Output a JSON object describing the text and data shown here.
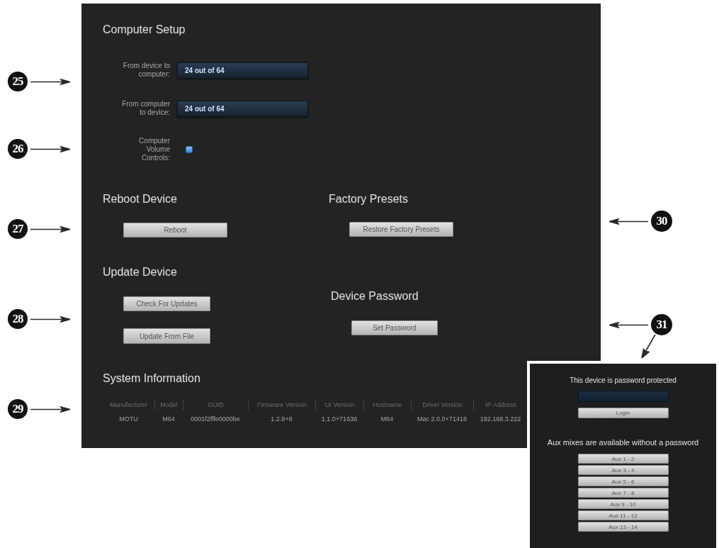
{
  "callouts": [
    {
      "number": "25",
      "kind": "arrow-right"
    },
    {
      "number": "26",
      "kind": "arrow-right"
    },
    {
      "number": "27",
      "kind": "arrow-right"
    },
    {
      "number": "28",
      "kind": "arrow-right"
    },
    {
      "number": "29",
      "kind": "arrow-right"
    },
    {
      "number": "30",
      "kind": "arrow-left"
    },
    {
      "number": "31",
      "kind": "arrow-left-down"
    }
  ],
  "settings": {
    "computer_setup": {
      "title": "Computer Setup",
      "fields": [
        {
          "label": "From device to computer:",
          "value": "24 out of 64"
        },
        {
          "label": "From computer to device:",
          "value": "24 out of 64"
        }
      ],
      "volume_controls": {
        "label": "Computer Volume Controls:",
        "checked": true
      }
    },
    "reboot_device": {
      "title": "Reboot Device",
      "button": "Reboot"
    },
    "update_device": {
      "title": "Update Device",
      "buttons": [
        "Check For Updates",
        "Update From File"
      ]
    },
    "factory_presets": {
      "title": "Factory Presets",
      "button": "Restore Factory Presets"
    },
    "device_password": {
      "title": "Device Password",
      "button": "Set Password"
    },
    "system_information": {
      "title": "System Information",
      "columns": [
        "Manufacturer",
        "Model",
        "GUID",
        "Firmware Version",
        "UI Version",
        "Hostname",
        "Driver Version",
        "IP Address"
      ],
      "rows": [
        [
          "MOTU",
          "M64",
          "0001f2fffe0000be",
          "1.2.9+8",
          "1.1.0+71636",
          "M64",
          "Mac 2.0.0+71418",
          "192.168.3.222"
        ]
      ]
    }
  },
  "login_panel": {
    "message": "This device is password protected",
    "button": "Login",
    "aux_note": "Aux mixes are available without a password",
    "aux_buttons": [
      "Aux 1 - 2",
      "Aux 3 - 4",
      "Aux 5 - 6",
      "Aux 7 - 8",
      "Aux 9 - 10",
      "Aux 11 - 12",
      "Aux 13 - 14"
    ]
  }
}
